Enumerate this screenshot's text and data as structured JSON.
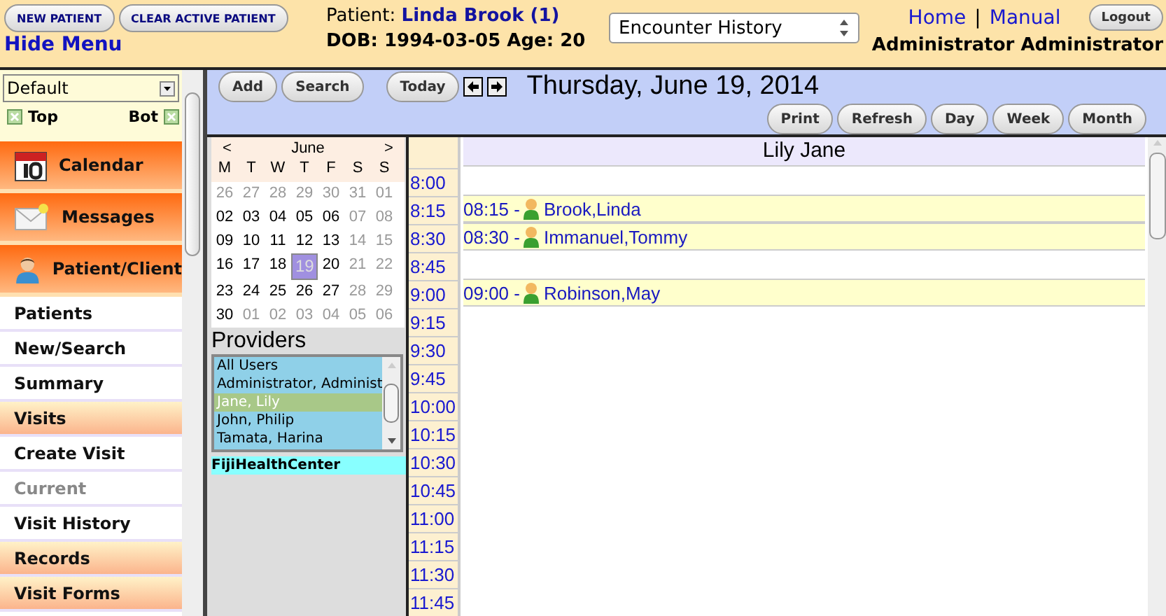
{
  "header": {
    "buttons": [
      "NEW PATIENT",
      "CLEAR ACTIVE PATIENT"
    ],
    "hide_menu": "Hide Menu",
    "patient_label": "Patient:",
    "patient_name": "Linda Brook (1)",
    "dob": "DOB: 1994-03-05 Age: 20",
    "encounter_select": "Encounter History",
    "links": [
      "Home",
      "Manual"
    ],
    "separator": "|",
    "logout": "Logout",
    "user": "Administrator Administrator"
  },
  "sidebar": {
    "select": "Default",
    "top_label": "Top",
    "bot_label": "Bot",
    "items": [
      {
        "kind": "main",
        "label": "Calendar",
        "disabled": false
      },
      {
        "kind": "main",
        "label": "Messages",
        "disabled": false
      },
      {
        "kind": "main",
        "label": "Patient/Client",
        "disabled": false
      },
      {
        "kind": "sub",
        "label": "Patients",
        "disabled": false
      },
      {
        "kind": "sub",
        "label": "New/Search",
        "disabled": false
      },
      {
        "kind": "sub",
        "label": "Summary",
        "disabled": false
      },
      {
        "kind": "section",
        "label": "Visits",
        "disabled": false
      },
      {
        "kind": "sub",
        "label": "Create Visit",
        "disabled": false
      },
      {
        "kind": "sub",
        "label": "Current",
        "disabled": true
      },
      {
        "kind": "sub",
        "label": "Visit History",
        "disabled": false
      },
      {
        "kind": "section",
        "label": "Records",
        "disabled": false
      },
      {
        "kind": "section",
        "label": "Visit Forms",
        "disabled": false
      }
    ]
  },
  "toolbar": {
    "left_buttons": [
      "Add",
      "Search"
    ],
    "today": "Today",
    "date": "Thursday, June 19, 2014",
    "view_buttons": [
      "Print",
      "Refresh",
      "Day",
      "Week",
      "Month"
    ]
  },
  "mini_calendar": {
    "prev": "<",
    "month": "June",
    "next": ">",
    "weekdays": [
      "M",
      "T",
      "W",
      "T",
      "F",
      "S",
      "S"
    ],
    "weeks": [
      [
        {
          "day": "26",
          "muted": true,
          "selected": false
        },
        {
          "day": "27",
          "muted": true,
          "selected": false
        },
        {
          "day": "28",
          "muted": true,
          "selected": false
        },
        {
          "day": "29",
          "muted": true,
          "selected": false
        },
        {
          "day": "30",
          "muted": true,
          "selected": false
        },
        {
          "day": "31",
          "muted": true,
          "selected": false
        },
        {
          "day": "01",
          "muted": true,
          "selected": false
        }
      ],
      [
        {
          "day": "02",
          "muted": false,
          "selected": false
        },
        {
          "day": "03",
          "muted": false,
          "selected": false
        },
        {
          "day": "04",
          "muted": false,
          "selected": false
        },
        {
          "day": "05",
          "muted": false,
          "selected": false
        },
        {
          "day": "06",
          "muted": false,
          "selected": false
        },
        {
          "day": "07",
          "muted": true,
          "selected": false
        },
        {
          "day": "08",
          "muted": true,
          "selected": false
        }
      ],
      [
        {
          "day": "09",
          "muted": false,
          "selected": false
        },
        {
          "day": "10",
          "muted": false,
          "selected": false
        },
        {
          "day": "11",
          "muted": false,
          "selected": false
        },
        {
          "day": "12",
          "muted": false,
          "selected": false
        },
        {
          "day": "13",
          "muted": false,
          "selected": false
        },
        {
          "day": "14",
          "muted": true,
          "selected": false
        },
        {
          "day": "15",
          "muted": true,
          "selected": false
        }
      ],
      [
        {
          "day": "16",
          "muted": false,
          "selected": false
        },
        {
          "day": "17",
          "muted": false,
          "selected": false
        },
        {
          "day": "18",
          "muted": false,
          "selected": false
        },
        {
          "day": "19",
          "muted": false,
          "selected": true
        },
        {
          "day": "20",
          "muted": false,
          "selected": false
        },
        {
          "day": "21",
          "muted": true,
          "selected": false
        },
        {
          "day": "22",
          "muted": true,
          "selected": false
        }
      ],
      [
        {
          "day": "23",
          "muted": false,
          "selected": false
        },
        {
          "day": "24",
          "muted": false,
          "selected": false
        },
        {
          "day": "25",
          "muted": false,
          "selected": false
        },
        {
          "day": "26",
          "muted": false,
          "selected": false
        },
        {
          "day": "27",
          "muted": false,
          "selected": false
        },
        {
          "day": "28",
          "muted": true,
          "selected": false
        },
        {
          "day": "29",
          "muted": true,
          "selected": false
        }
      ],
      [
        {
          "day": "30",
          "muted": false,
          "selected": false
        },
        {
          "day": "01",
          "muted": true,
          "selected": false
        },
        {
          "day": "02",
          "muted": true,
          "selected": false
        },
        {
          "day": "03",
          "muted": true,
          "selected": false
        },
        {
          "day": "04",
          "muted": true,
          "selected": false
        },
        {
          "day": "05",
          "muted": true,
          "selected": false
        },
        {
          "day": "06",
          "muted": true,
          "selected": false
        }
      ]
    ]
  },
  "providers": {
    "title": "Providers",
    "items": [
      {
        "name": "All Users",
        "selected": false
      },
      {
        "name": "Administrator, Administ",
        "selected": false
      },
      {
        "name": "Jane, Lily",
        "selected": true
      },
      {
        "name": "John, Philip",
        "selected": false
      },
      {
        "name": "Tamata, Harina",
        "selected": false
      }
    ],
    "facility": "FijiHealthCenter"
  },
  "schedule": {
    "provider": "Lily Jane",
    "slots": [
      {
        "time": "8:00"
      },
      {
        "time": "8:15",
        "appointment": {
          "time": "08:15 -",
          "patient": "Brook,Linda"
        }
      },
      {
        "time": "8:30",
        "appointment": {
          "time": "08:30 -",
          "patient": "Immanuel,Tommy"
        }
      },
      {
        "time": "8:45"
      },
      {
        "time": "9:00",
        "appointment": {
          "time": "09:00 -",
          "patient": "Robinson,May"
        }
      },
      {
        "time": "9:15"
      },
      {
        "time": "9:30"
      },
      {
        "time": "9:45"
      },
      {
        "time": "10:00"
      },
      {
        "time": "10:15"
      },
      {
        "time": "10:30"
      },
      {
        "time": "10:45"
      },
      {
        "time": "11:00"
      },
      {
        "time": "11:15"
      },
      {
        "time": "11:30"
      },
      {
        "time": "11:45"
      }
    ]
  }
}
